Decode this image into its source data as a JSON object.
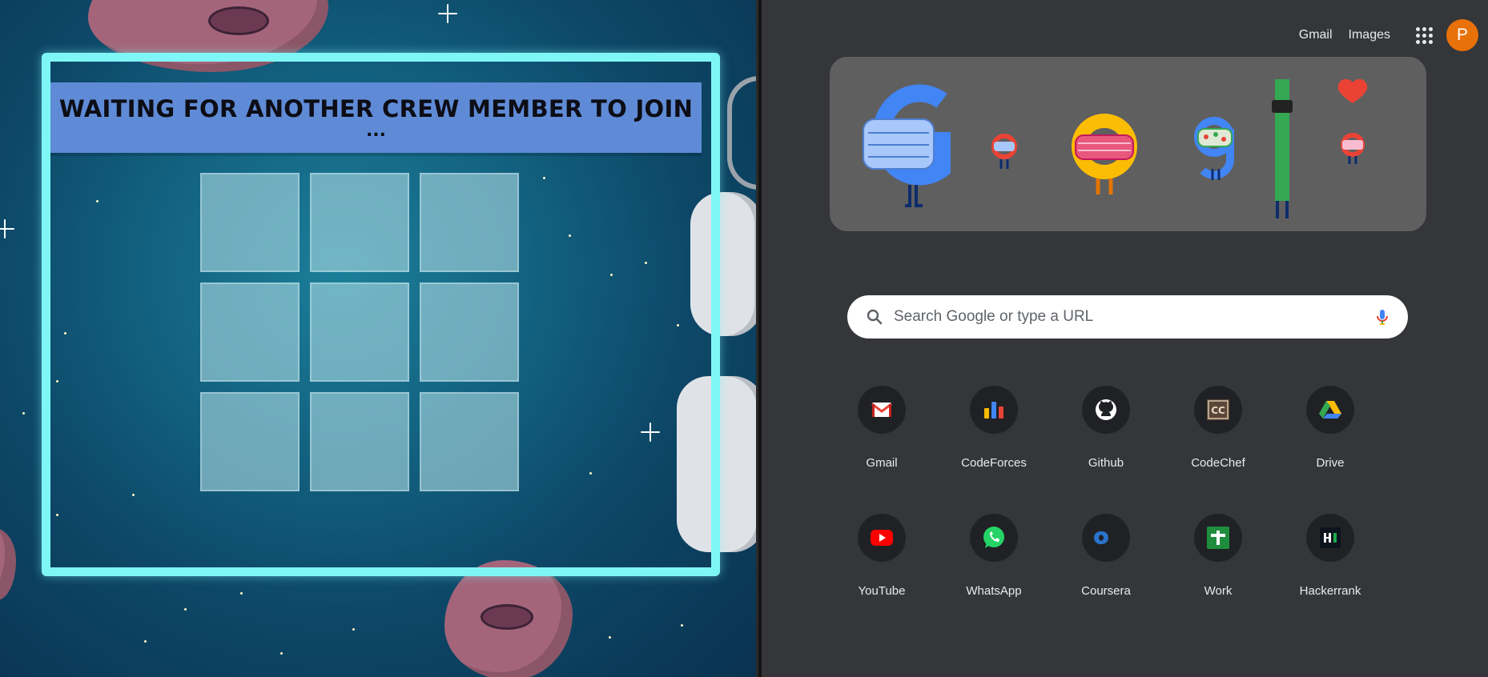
{
  "game": {
    "waiting_title": "WAITING FOR ANOTHER CREW MEMBER TO JOIN",
    "waiting_dots": "...",
    "grid_cells": 9
  },
  "ntp": {
    "top_links": {
      "gmail": "Gmail",
      "images": "Images"
    },
    "avatar_initial": "P",
    "search": {
      "placeholder": "Search Google or type a URL"
    },
    "shortcuts": [
      {
        "label": "Gmail",
        "icon": "gmail-icon"
      },
      {
        "label": "CodeForces",
        "icon": "codeforces-icon"
      },
      {
        "label": "Github",
        "icon": "github-icon"
      },
      {
        "label": "CodeChef",
        "icon": "codechef-icon"
      },
      {
        "label": "Drive",
        "icon": "drive-icon"
      },
      {
        "label": "YouTube",
        "icon": "youtube-icon"
      },
      {
        "label": "WhatsApp",
        "icon": "whatsapp-icon"
      },
      {
        "label": "Coursera",
        "icon": "coursera-icon"
      },
      {
        "label": "Work",
        "icon": "work-icon"
      },
      {
        "label": "Hackerrank",
        "icon": "hackerrank-icon"
      }
    ],
    "colors": {
      "background": "#35363a",
      "doodle_bg": "#5f5f60",
      "avatar": "#e8710a"
    }
  }
}
